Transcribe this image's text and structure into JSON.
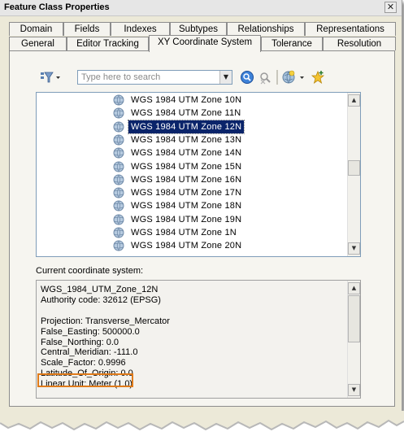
{
  "window": {
    "title": "Feature Class Properties",
    "close_symbol": "✕"
  },
  "tabs_back": [
    {
      "label": "Domain"
    },
    {
      "label": "Fields"
    },
    {
      "label": "Indexes"
    },
    {
      "label": "Subtypes"
    },
    {
      "label": "Relationships"
    },
    {
      "label": "Representations"
    }
  ],
  "tabs_front": [
    {
      "label": "General"
    },
    {
      "label": "Editor Tracking"
    },
    {
      "label": "XY Coordinate System",
      "active": true
    },
    {
      "label": "Tolerance"
    },
    {
      "label": "Resolution"
    }
  ],
  "toolbar": {
    "filter_icon": "filter-icon",
    "search_placeholder": "Type here to search",
    "search_value": "",
    "search_button_icon": "magnifier-icon",
    "clear_search_icon": "clear-search-icon",
    "add_coordinate_system_icon": "globe-add-icon",
    "favorites_icon": "favorite-star-icon"
  },
  "coordinate_list": {
    "items": [
      {
        "label": "WGS 1984 UTM Zone 10N"
      },
      {
        "label": "WGS 1984 UTM Zone 11N"
      },
      {
        "label": "WGS 1984 UTM Zone 12N",
        "selected": true
      },
      {
        "label": "WGS 1984 UTM Zone 13N"
      },
      {
        "label": "WGS 1984 UTM Zone 14N"
      },
      {
        "label": "WGS 1984 UTM Zone 15N"
      },
      {
        "label": "WGS 1984 UTM Zone 16N"
      },
      {
        "label": "WGS 1984 UTM Zone 17N"
      },
      {
        "label": "WGS 1984 UTM Zone 18N"
      },
      {
        "label": "WGS 1984 UTM Zone 19N"
      },
      {
        "label": "WGS 1984 UTM Zone 1N"
      },
      {
        "label": "WGS 1984 UTM Zone 20N"
      }
    ]
  },
  "current_system": {
    "label": "Current coordinate system:",
    "lines": [
      "WGS_1984_UTM_Zone_12N",
      "Authority code: 32612 (EPSG)",
      "",
      "Projection: Transverse_Mercator",
      "False_Easting: 500000.0",
      "False_Northing: 0.0",
      "Central_Meridian: -111.0",
      "Scale_Factor: 0.9996",
      "Latitude_Of_Origin: 0.0",
      "Linear Unit: Meter (1.0)"
    ],
    "highlighted_line": "Linear Unit: Meter (1.0)",
    "highlight_color": "#e07b1a"
  },
  "colors": {
    "selection": "#0a246a",
    "dialog_bg": "#ece9d8",
    "panel_bg": "#f6f5f0"
  }
}
